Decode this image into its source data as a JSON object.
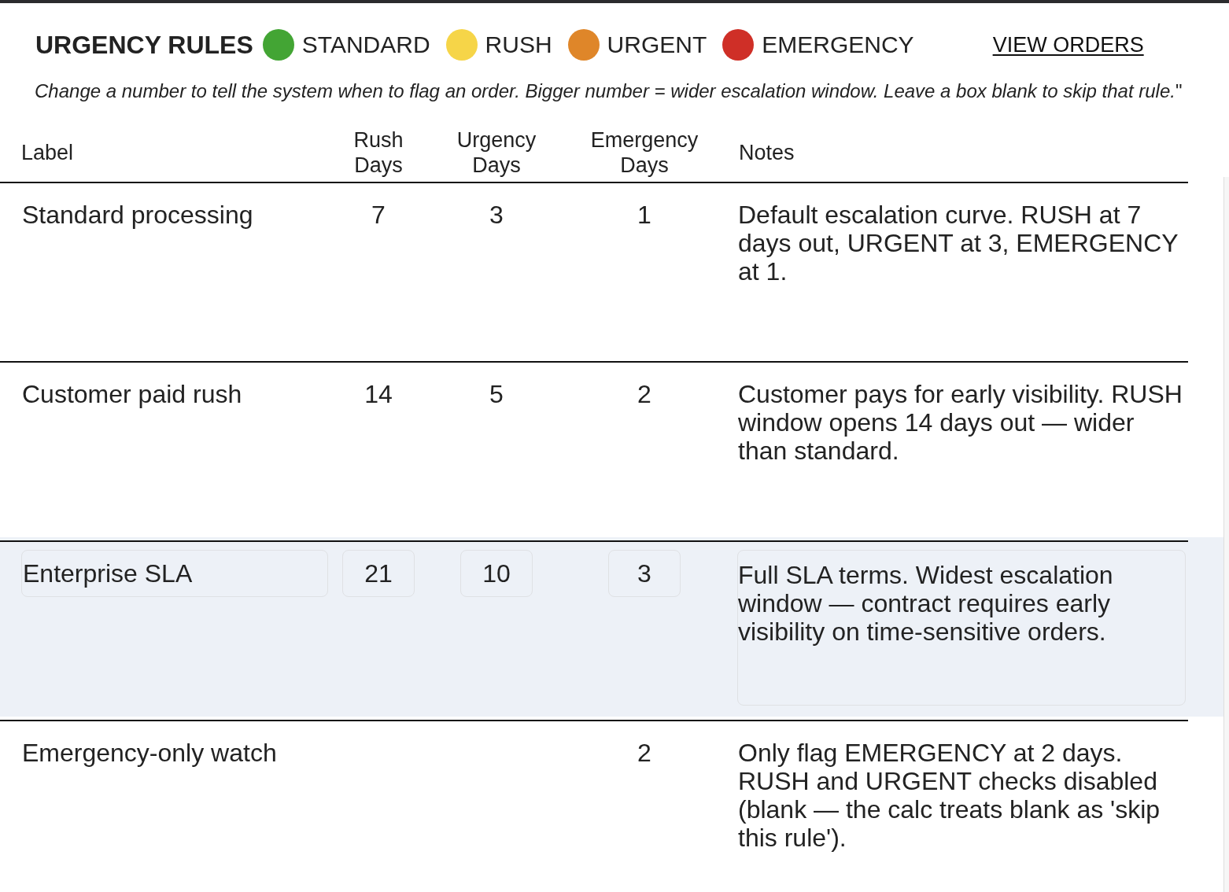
{
  "header": {
    "title": "URGENCY RULES",
    "legend": [
      {
        "label": "STANDARD",
        "color": "#43a534"
      },
      {
        "label": "RUSH",
        "color": "#f6d548"
      },
      {
        "label": "URGENT",
        "color": "#df8629"
      },
      {
        "label": "EMERGENCY",
        "color": "#cf2f27"
      }
    ],
    "link": "VIEW ORDERS"
  },
  "instructions": "*Change a number to tell the system when to flag an order. Bigger number = wider escalation window. Leave a box blank to skip that rule.*\"",
  "table": {
    "columns": [
      "Label",
      "Rush Days",
      "Urgency Days",
      "Emergency Days",
      "Notes"
    ],
    "rows": [
      {
        "label": "Standard processing",
        "rush_days": "7",
        "urgency_days": "3",
        "emergency_days": "1",
        "notes": "Default escalation curve. RUSH at 7 days out, URGENT at 3, EMERGENCY at 1.",
        "selected": false
      },
      {
        "label": "Customer paid rush",
        "rush_days": "14",
        "urgency_days": "5",
        "emergency_days": "2",
        "notes": "Customer pays for early visibility. RUSH window opens 14 days out — wider than standard.",
        "selected": false
      },
      {
        "label": "Enterprise SLA",
        "rush_days": "21",
        "urgency_days": "10",
        "emergency_days": "3",
        "notes": "Full SLA terms. Widest escalation window — contract requires early visibility on time-sensitive orders.",
        "selected": true
      },
      {
        "label": "Emergency-only watch",
        "emergency_days": "2",
        "notes": "Only flag EMERGENCY at 2 days. RUSH and URGENT checks disabled (blank — the calc treats blank as 'skip this rule').",
        "selected": false
      }
    ]
  }
}
